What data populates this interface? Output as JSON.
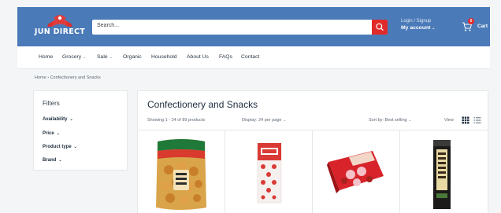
{
  "brand": {
    "logo_text": "JUN DIRECT"
  },
  "search": {
    "placeholder": "Search..."
  },
  "account": {
    "login_label": "Login / Signup",
    "account_label": "My account"
  },
  "cart": {
    "label": "Cart",
    "count": "0"
  },
  "nav": {
    "items": [
      {
        "label": "Home",
        "has_dropdown": false
      },
      {
        "label": "Grocery",
        "has_dropdown": true
      },
      {
        "label": "Sale",
        "has_dropdown": true
      },
      {
        "label": "Organic",
        "has_dropdown": false
      },
      {
        "label": "Household",
        "has_dropdown": false
      },
      {
        "label": "About Us",
        "has_dropdown": false
      },
      {
        "label": "FAQs",
        "has_dropdown": false
      },
      {
        "label": "Contact",
        "has_dropdown": false
      }
    ]
  },
  "breadcrumb": {
    "home": "Home",
    "separator": "›",
    "current": "Confectionery and Snacks"
  },
  "filters": {
    "title": "Filters",
    "items": [
      "Availability",
      "Price",
      "Product type",
      "Brand"
    ]
  },
  "collection": {
    "title": "Confectionery and Snacks",
    "showing": "Showing 1 - 24 of 89 products",
    "display": "Display: 24 per page",
    "sort": "Sort by: Best selling",
    "view_label": "View"
  },
  "colors": {
    "header": "#4a7ab8",
    "accent_red": "#e02b2b"
  }
}
